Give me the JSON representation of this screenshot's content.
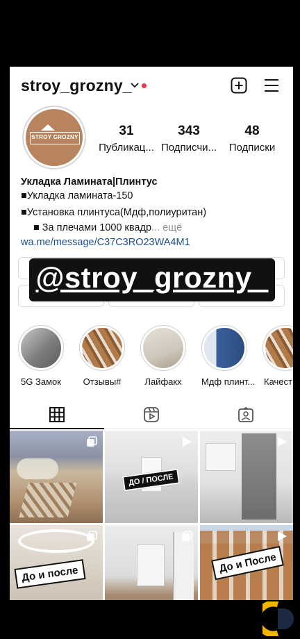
{
  "header": {
    "username": "stroy_grozny_",
    "icons": [
      "chevron-down-icon",
      "notification-dot",
      "add-post-icon",
      "menu-icon"
    ]
  },
  "profile": {
    "logo_text": "STROY GROZNY",
    "stats": [
      {
        "value": "31",
        "label": "Публикац..."
      },
      {
        "value": "343",
        "label": "Подписчи..."
      },
      {
        "value": "48",
        "label": "Подписки"
      }
    ],
    "bio": {
      "name": "Укладка Ламината|Плинтус",
      "line1": "■Укладка ламината-150",
      "line2": "■Установка плинтуса(Мдф,полиуритан)",
      "line3": "■ За плечами 1000 квадр",
      "more": "... ещё",
      "link": "wa.me/message/C37C3RO23WA4M1"
    }
  },
  "overlay": {
    "text": "@stroy_grozny_"
  },
  "highlights": [
    {
      "label": "5G Замок",
      "color": "#8a8a88"
    },
    {
      "label": "Отзывы#",
      "color": "#a36a3c"
    },
    {
      "label": "Лайфакх",
      "color": "#cfc7bb"
    },
    {
      "label": "Мдф плинт...",
      "color": "#3a5f9c"
    },
    {
      "label": "Качест",
      "color": "#a36a3c"
    }
  ],
  "tabs": [
    "grid-icon",
    "reels-icon",
    "tagged-icon"
  ],
  "posts": [
    {
      "sticker": "",
      "type": "carousel"
    },
    {
      "sticker": "ДО / ПОСЛЕ",
      "type": "video"
    },
    {
      "sticker": "",
      "type": "video"
    },
    {
      "sticker": "До и после",
      "type": "carousel"
    },
    {
      "sticker": "",
      "type": "carousel"
    },
    {
      "sticker": "До и После",
      "type": "video"
    }
  ]
}
